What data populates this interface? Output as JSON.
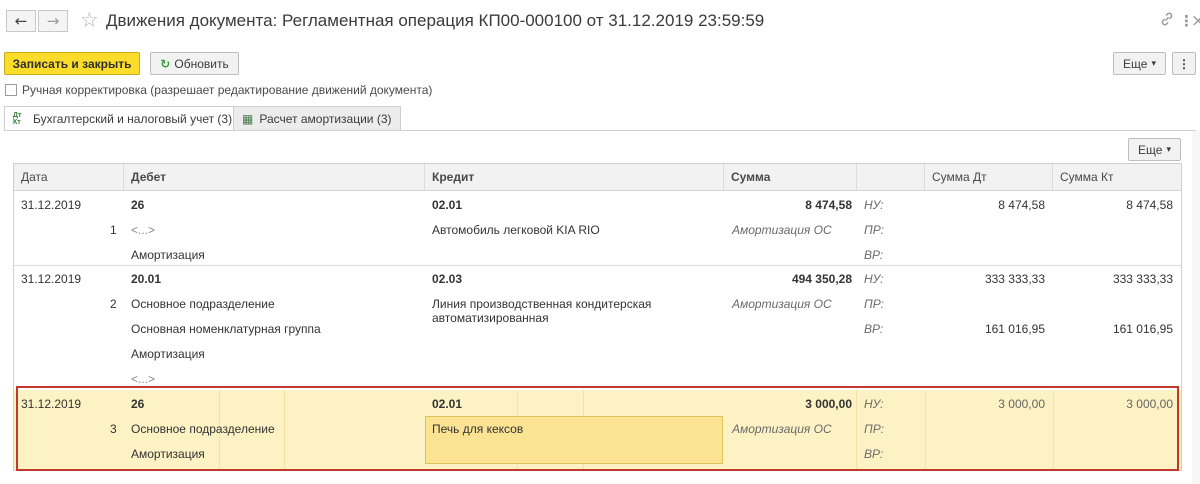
{
  "window": {
    "title": "Движения документа: Регламентная операция КП00-000100 от 31.12.2019 23:59:59",
    "back_icon": "←",
    "forward_icon": "→",
    "star_icon": "☆",
    "link_icon": "🔗",
    "more_icon": "⋮",
    "close_icon": "×"
  },
  "toolbar": {
    "save_close_label": "Записать и закрыть",
    "refresh_label": "Обновить",
    "refresh_icon": "↻",
    "more_label": "Еще",
    "more_arrow": "▾"
  },
  "manual_correction": {
    "label": "Ручная корректировка (разрешает редактирование движений документа)",
    "checked": false
  },
  "tabs": [
    {
      "icon": "ДтКт",
      "label": "Бухгалтерский и налоговый учет (3)",
      "active": true
    },
    {
      "icon": "▦",
      "label": "Расчет амортизации (3)",
      "active": false
    }
  ],
  "grid": {
    "more_label": "Еще",
    "more_arrow": "▾",
    "columns": [
      "Дата",
      "Дебет",
      "Кредит",
      "Сумма",
      "",
      "Сумма Дт",
      "Сумма Кт"
    ],
    "records": [
      {
        "date": "31.12.2019",
        "num": "1",
        "debit": [
          "26",
          "<...>",
          "Амортизация"
        ],
        "credit": [
          "02.01",
          "Автомобиль легковой KIA RIO",
          ""
        ],
        "amount": "8 474,58",
        "amount_note": "Амортизация ОС",
        "tax_labels": [
          "НУ:",
          "ПР:",
          "ВР:"
        ],
        "sum_dt": [
          "8 474,58",
          "",
          ""
        ],
        "sum_kt": [
          "8 474,58",
          "",
          ""
        ]
      },
      {
        "date": "31.12.2019",
        "num": "2",
        "debit": [
          "20.01",
          "Основное подразделение",
          "Основная номенклатурная группа",
          "Амортизация",
          "<...>"
        ],
        "credit": [
          "02.03",
          "Линия производственная кондитерская автоматизированная",
          ""
        ],
        "amount": "494 350,28",
        "amount_note": "Амортизация ОС",
        "tax_labels": [
          "НУ:",
          "ПР:",
          "ВР:"
        ],
        "sum_dt": [
          "333 333,33",
          "",
          "161 016,95"
        ],
        "sum_kt": [
          "333 333,33",
          "",
          "161 016,95"
        ]
      },
      {
        "date": "31.12.2019",
        "num": "3",
        "debit": [
          "26",
          "Основное подразделение",
          "Амортизация"
        ],
        "credit": [
          "02.01",
          "Печь для кексов",
          ""
        ],
        "amount": "3 000,00",
        "amount_note": "Амортизация ОС",
        "tax_labels": [
          "НУ:",
          "ПР:",
          "ВР:"
        ],
        "sum_dt": [
          "3 000,00",
          "",
          ""
        ],
        "sum_kt": [
          "3 000,00",
          "",
          ""
        ]
      }
    ]
  },
  "colors": {
    "primary_button": "#fbdc2a",
    "row_highlight": "#fdf2c4",
    "cell_highlight": "#fbe394",
    "annotation_frame": "#c0392b"
  }
}
